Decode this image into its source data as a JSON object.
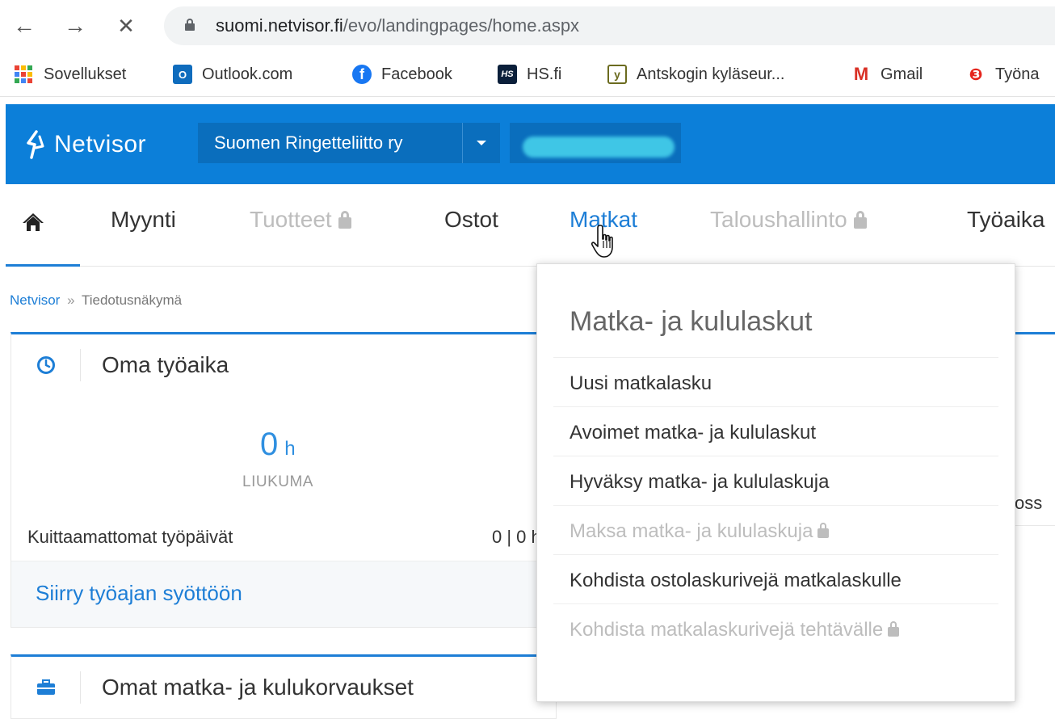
{
  "browser": {
    "back_icon": "←",
    "forward_icon": "→",
    "stop_icon": "✕",
    "url_host": "suomi.netvisor.fi",
    "url_path": "/evo/landingpages/home.aspx"
  },
  "bookmarks": [
    {
      "label": "Sovellukset",
      "icon": "apps-grid-icon"
    },
    {
      "label": "Outlook.com",
      "icon": "outlook-icon",
      "color": "#0f6cbd",
      "glyph": "O"
    },
    {
      "label": "Facebook",
      "icon": "facebook-icon",
      "color": "#1877f2",
      "glyph": "f"
    },
    {
      "label": "HS.fi",
      "icon": "hs-icon",
      "color": "#0b1f3a",
      "glyph": "HS"
    },
    {
      "label": "Antskogin kyläseur...",
      "icon": "antskog-icon",
      "color": "#6b6b1f",
      "glyph": "y"
    },
    {
      "label": "Gmail",
      "icon": "gmail-icon",
      "color": "#d93025",
      "glyph": "M"
    },
    {
      "label": "Työna",
      "icon": "tyo-icon",
      "color": "#e5251d",
      "glyph": "❸"
    }
  ],
  "header": {
    "logo_text": "Netvisor",
    "company": "Suomen Ringetteliitto ry",
    "brand_color": "#0c7fd9"
  },
  "main_nav": {
    "items": [
      {
        "label": "Myynti",
        "locked": false
      },
      {
        "label": "Tuotteet",
        "locked": true
      },
      {
        "label": "Ostot",
        "locked": false
      },
      {
        "label": "Matkat",
        "locked": false,
        "active": true
      },
      {
        "label": "Taloushallinto",
        "locked": true
      },
      {
        "label": "Työaika",
        "locked": false
      }
    ]
  },
  "breadcrumb": {
    "root": "Netvisor",
    "separator": "»",
    "current": "Tiedotusnäkymä"
  },
  "widget_worktime": {
    "title": "Oma työaika",
    "value": "0",
    "unit": "h",
    "value_label": "LIUKUMA",
    "row_label": "Kuittaamattomat työpäivät",
    "row_value": "0 | 0 h",
    "footer_link": "Siirry työajan syöttöön"
  },
  "widget_expenses": {
    "title": "Omat matka- ja kulukorvaukset"
  },
  "right_widget_fragment": "oss",
  "dropdown": {
    "title": "Matka- ja kululaskut",
    "items": [
      {
        "label": "Uusi matkalasku",
        "locked": false
      },
      {
        "label": "Avoimet matka- ja kululaskut",
        "locked": false
      },
      {
        "label": "Hyväksy matka- ja kululaskuja",
        "locked": false
      },
      {
        "label": "Maksa matka- ja kululaskuja",
        "locked": true
      },
      {
        "label": "Kohdista ostolaskurivejä matkalaskulle",
        "locked": false
      },
      {
        "label": "Kohdista matkalaskurivejä tehtävälle",
        "locked": true
      }
    ]
  }
}
